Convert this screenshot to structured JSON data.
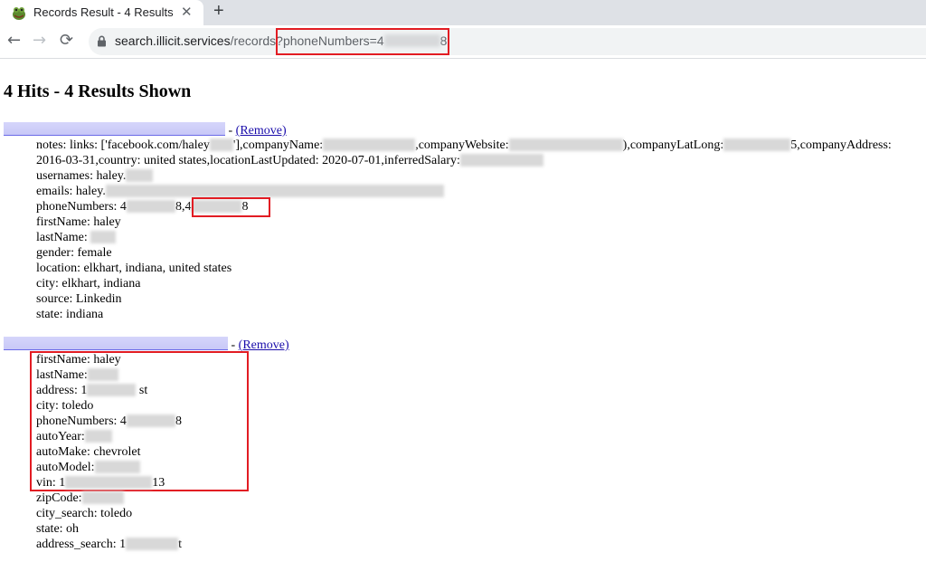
{
  "browser": {
    "tab_title": "Records Result - 4 Results",
    "close_glyph": "✕",
    "newtab_glyph": "+",
    "back_glyph": "←",
    "forward_glyph": "→",
    "reload_glyph": "⟳",
    "url_host": "search.illicit.services",
    "url_path": "/records?",
    "url_query_start": "phoneNumbers=4",
    "url_query_end": "8"
  },
  "page": {
    "heading": "4 Hits - 4 Results Shown"
  },
  "records": [
    {
      "separator": " - ",
      "remove_label": "(Remove)",
      "notes_a": "notes: links: ['facebook.com/haley",
      "notes_b": "'],companyName:",
      "notes_c": ",companyWebsite:",
      "notes_d": "),companyLatLong:",
      "notes_e": "5,companyAddress:",
      "notes_line2": "2016-03-31,country: united states,locationLastUpdated: 2020-07-01,inferredSalary:",
      "usernames": "usernames: haley.",
      "emails": "emails: haley.",
      "phone_a": "phoneNumbers: 4",
      "phone_b": "8,",
      "phone_c": "4",
      "phone_d": "8",
      "first_name": "firstName: haley",
      "last_name": "lastName:",
      "gender": "gender: female",
      "location": "location: elkhart, indiana, united states",
      "city": "city: elkhart, indiana",
      "source": "source: Linkedin",
      "state": "state: indiana"
    },
    {
      "separator": " - ",
      "remove_label": "(Remove)",
      "first_name": "firstName: haley",
      "last_name": "lastName:",
      "address_a": "address: 1",
      "address_b": "st",
      "city": "city: toledo",
      "phone_a": "phoneNumbers: 4",
      "phone_b": "8",
      "auto_year": "autoYear:",
      "auto_make": "autoMake: chevrolet",
      "auto_model": "autoModel:",
      "vin_a": "vin: 1",
      "vin_b": "13",
      "zip": "zipCode:",
      "city_search": "city_search: toledo",
      "state": "state: oh",
      "address_search_a": "address_search: 1",
      "address_search_b": "t"
    }
  ],
  "colors": {
    "highlight": "#e21c23",
    "link": "#1a0dab"
  }
}
